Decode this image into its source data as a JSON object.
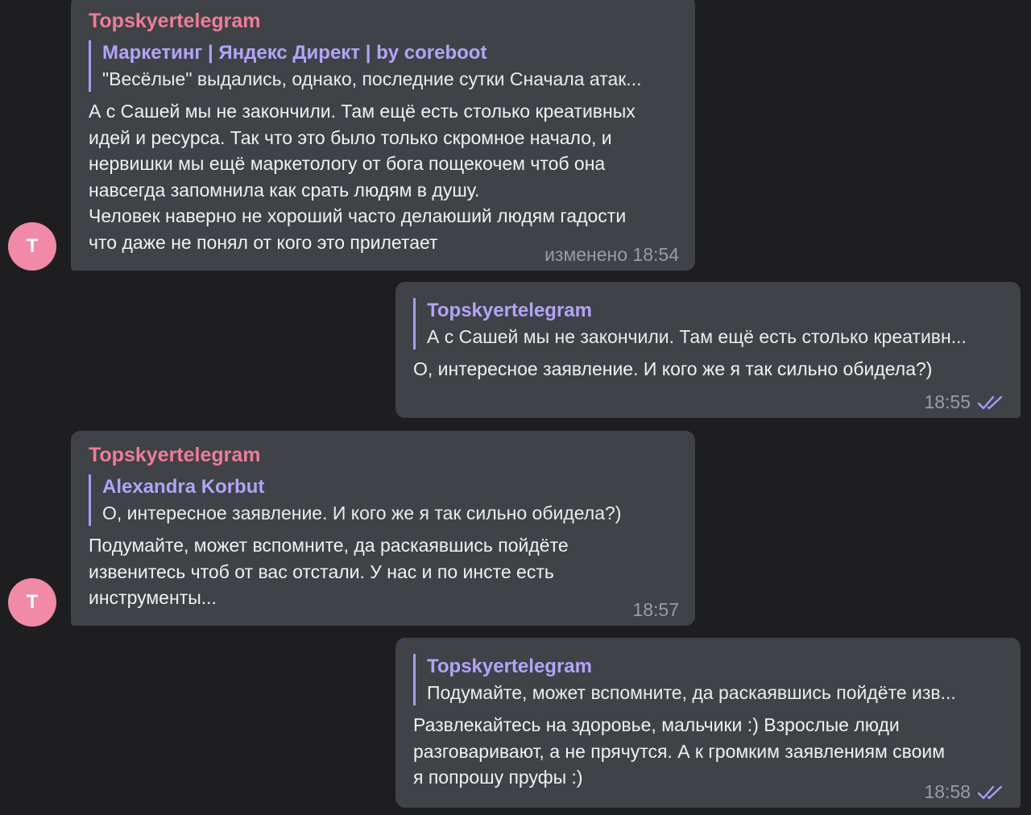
{
  "messages": [
    {
      "sender": "Topskyertelegram",
      "reply": {
        "author": "Маркетинг | Яндекс Директ | by coreboot",
        "text": "\"Весёлые\" выдались, однако, последние сутки  Сначала атак..."
      },
      "text": "А с Сашей мы не закончили. Там ещё есть столько креативных\nидей и ресурса. Так что это было только скромное начало, и\nнервишки мы ещё маркетологу от бога пощекочем чтоб она\nнавсегда запомнила как срать людям в душу.\nЧеловек наверно не хороший часто делаюший людям гадости\nчто даже не понял от кого это прилетает",
      "time": "изменено 18:54",
      "avatar_letter": "T"
    },
    {
      "reply": {
        "author": "Topskyertelegram",
        "text": "А с Сашей мы не закончили. Там ещё есть столько креативн..."
      },
      "text": "О, интересное заявление. И кого же я так сильно обидела?)",
      "time": "18:55",
      "status_icon": "double-check-icon"
    },
    {
      "sender": "Topskyertelegram",
      "reply": {
        "author": "Alexandra Korbut",
        "text": "О, интересное заявление. И кого же я так сильно обидела?)"
      },
      "text": "Подумайте, может вспомните, да раскаявшись пойдёте\nизвенитесь чтоб от вас отстали. У нас и по инсте есть\nинструменты...",
      "time": "18:57",
      "avatar_letter": "T"
    },
    {
      "reply": {
        "author": "Topskyertelegram",
        "text": "Подумайте, может вспомните, да раскаявшись пойдёте изв..."
      },
      "text": "Развлекайтесь на здоровье, мальчики :) Взрослые люди\nразговаривают, а не прячутся. А к громким заявлениям своим\nя попрошу пруфы :)",
      "time": "18:58",
      "status_icon": "double-check-icon"
    }
  ],
  "colors": {
    "background": "#1e1e21",
    "bubble": "#3f4247",
    "sender": "#ee7c9a",
    "reply_author": "#b3a4f7",
    "reply_bar": "#a79bf5",
    "time": "#9a9ca1",
    "avatar": "#f08aa7"
  }
}
